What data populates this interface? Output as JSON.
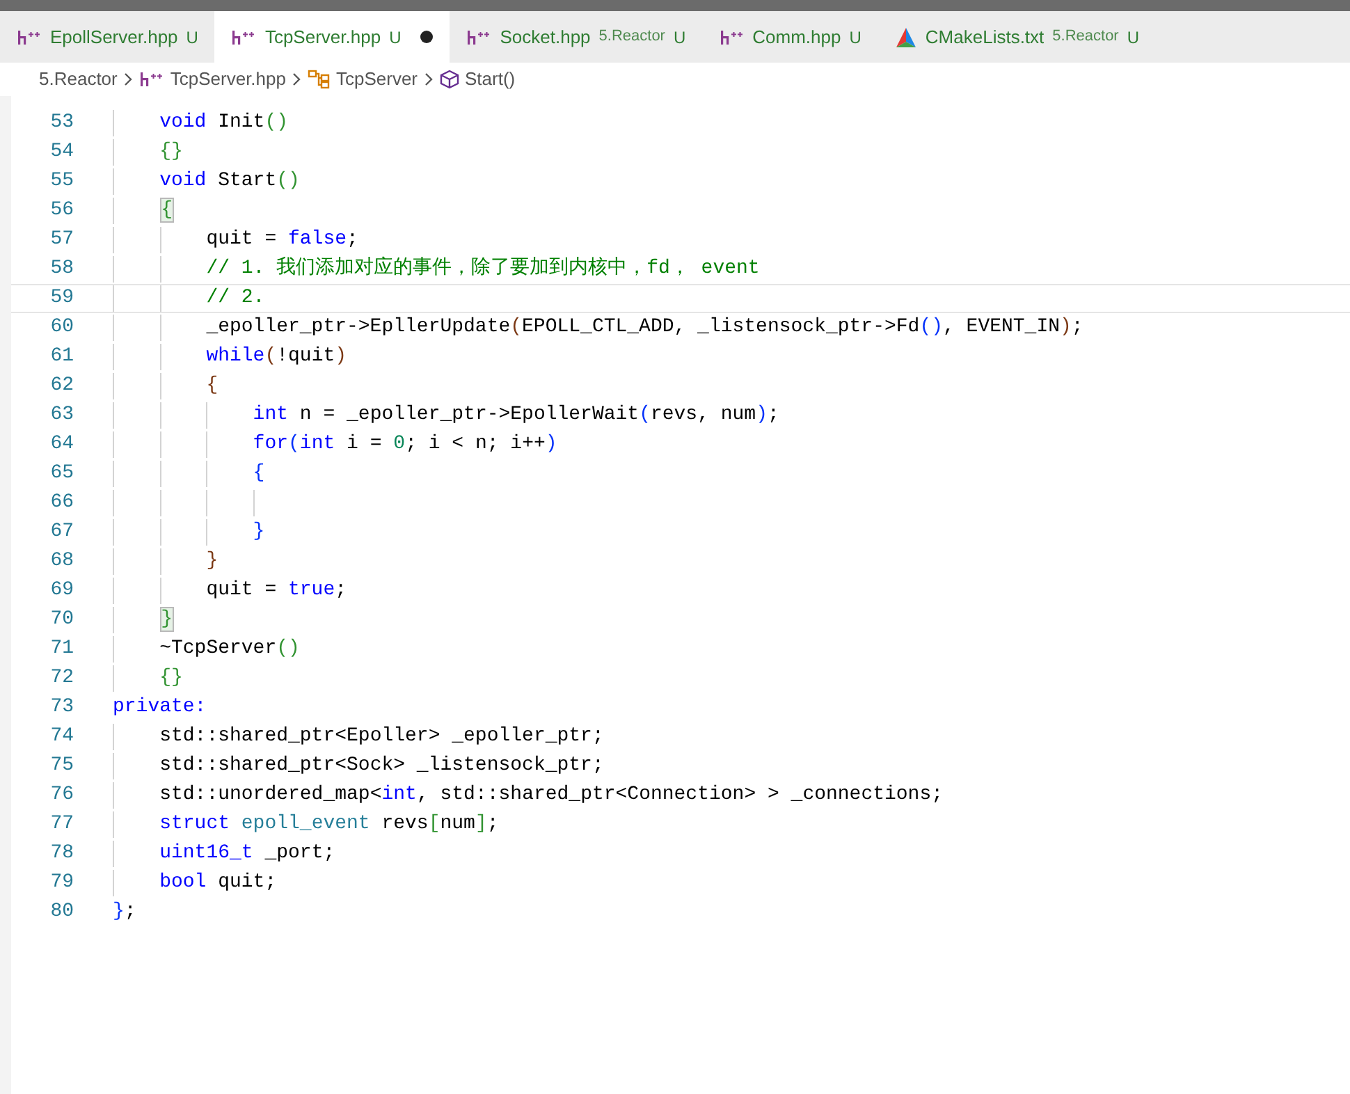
{
  "tabs": [
    {
      "kind": "header",
      "label": "EpollServer.hpp",
      "status": "U",
      "modified": false,
      "selected": false
    },
    {
      "kind": "header",
      "label": "TcpServer.hpp",
      "status": "U",
      "modified": true,
      "selected": true
    },
    {
      "kind": "header",
      "label": "Socket.hpp",
      "detail": "5.Reactor",
      "status": "U",
      "modified": false,
      "selected": false
    },
    {
      "kind": "header",
      "label": "Comm.hpp",
      "status": "U",
      "modified": false,
      "selected": false
    },
    {
      "kind": "cmake",
      "label": "CMakeLists.txt",
      "detail": "5.Reactor",
      "status": "U",
      "modified": false,
      "selected": false
    }
  ],
  "breadcrumb": [
    {
      "kind": "folder",
      "label": "5.Reactor"
    },
    {
      "kind": "header",
      "label": "TcpServer.hpp"
    },
    {
      "kind": "class",
      "label": "TcpServer"
    },
    {
      "kind": "method",
      "label": "Start()"
    }
  ],
  "editor": {
    "lines": [
      {
        "children": [
          {
            "number": "53",
            "current": false,
            "tokens": [
              {
                "kind": "kw",
                "text": "void"
              },
              {
                "kind": "plain",
                "text": " Init"
              },
              {
                "kind": "b1",
                "text": "()"
              }
            ]
          },
          {
            "number": "54",
            "current": false,
            "tokens": [
              {
                "kind": "b1",
                "text": "{}"
              }
            ]
          },
          {
            "number": "55",
            "current": false,
            "tokens": [
              {
                "kind": "kw",
                "text": "void"
              },
              {
                "kind": "plain",
                "text": " Start"
              },
              {
                "kind": "b1",
                "text": "()"
              }
            ]
          },
          {
            "number": "56",
            "current": false,
            "tokens": [
              {
                "kind": "b1",
                "text": "{",
                "matched": true
              }
            ],
            "children": [
              {
                "number": "57",
                "current": false,
                "tokens": [
                  {
                    "kind": "plain",
                    "text": "quit = "
                  },
                  {
                    "kind": "kw",
                    "text": "false"
                  },
                  {
                    "kind": "plain",
                    "text": ";"
                  }
                ]
              },
              {
                "number": "58",
                "current": false,
                "tokens": [
                  {
                    "kind": "comment",
                    "text": "// 1. 我们添加对应的事件，除了要加到内核中，fd， event"
                  }
                ]
              },
              {
                "number": "59",
                "current": true,
                "tokens": [
                  {
                    "kind": "comment",
                    "text": "// 2."
                  }
                ]
              },
              {
                "number": "60",
                "current": false,
                "tokens": [
                  {
                    "kind": "plain",
                    "text": "_epoller_ptr->EpllerUpdate"
                  },
                  {
                    "kind": "b2",
                    "text": "("
                  },
                  {
                    "kind": "plain",
                    "text": "EPOLL_CTL_ADD, _listensock_ptr->Fd"
                  },
                  {
                    "kind": "b3",
                    "text": "()"
                  },
                  {
                    "kind": "plain",
                    "text": ", EVENT_IN"
                  },
                  {
                    "kind": "b2",
                    "text": ")"
                  },
                  {
                    "kind": "plain",
                    "text": ";"
                  }
                ]
              },
              {
                "number": "61",
                "current": false,
                "tokens": [
                  {
                    "kind": "kw",
                    "text": "while"
                  },
                  {
                    "kind": "b2",
                    "text": "("
                  },
                  {
                    "kind": "plain",
                    "text": "!quit"
                  },
                  {
                    "kind": "b2",
                    "text": ")"
                  }
                ]
              },
              {
                "number": "62",
                "current": false,
                "tokens": [
                  {
                    "kind": "b2",
                    "text": "{"
                  }
                ],
                "children": [
                  {
                    "number": "63",
                    "current": false,
                    "tokens": [
                      {
                        "kind": "kw",
                        "text": "int"
                      },
                      {
                        "kind": "plain",
                        "text": " n = _epoller_ptr->EpollerWait"
                      },
                      {
                        "kind": "b3",
                        "text": "("
                      },
                      {
                        "kind": "plain",
                        "text": "revs, num"
                      },
                      {
                        "kind": "b3",
                        "text": ")"
                      },
                      {
                        "kind": "plain",
                        "text": ";"
                      }
                    ]
                  },
                  {
                    "number": "64",
                    "current": false,
                    "tokens": [
                      {
                        "kind": "kw",
                        "text": "for"
                      },
                      {
                        "kind": "b3",
                        "text": "("
                      },
                      {
                        "kind": "kw",
                        "text": "int"
                      },
                      {
                        "kind": "plain",
                        "text": " i = "
                      },
                      {
                        "kind": "num",
                        "text": "0"
                      },
                      {
                        "kind": "plain",
                        "text": "; i < n; i++"
                      },
                      {
                        "kind": "b3",
                        "text": ")"
                      }
                    ]
                  },
                  {
                    "number": "65",
                    "current": false,
                    "tokens": [
                      {
                        "kind": "b3",
                        "text": "{"
                      }
                    ],
                    "children": [
                      {
                        "number": "66",
                        "current": false
                      }
                    ]
                  },
                  {
                    "number": "67",
                    "current": false,
                    "tokens": [
                      {
                        "kind": "b3",
                        "text": "}"
                      }
                    ]
                  }
                ]
              },
              {
                "number": "68",
                "current": false,
                "tokens": [
                  {
                    "kind": "b2",
                    "text": "}"
                  }
                ]
              },
              {
                "number": "69",
                "current": false,
                "tokens": [
                  {
                    "kind": "plain",
                    "text": "quit = "
                  },
                  {
                    "kind": "kw",
                    "text": "true"
                  },
                  {
                    "kind": "plain",
                    "text": ";"
                  }
                ]
              }
            ]
          },
          {
            "number": "70",
            "current": false,
            "tokens": [
              {
                "kind": "b1",
                "text": "}",
                "matched": true
              }
            ]
          },
          {
            "number": "71",
            "current": false,
            "tokens": [
              {
                "kind": "plain",
                "text": "~TcpServer"
              },
              {
                "kind": "b1",
                "text": "()"
              }
            ]
          },
          {
            "number": "72",
            "current": false,
            "tokens": [
              {
                "kind": "b1",
                "text": "{}"
              }
            ]
          }
        ]
      },
      {
        "number": "73",
        "current": false,
        "tokens": [
          {
            "kind": "kw",
            "text": "private:"
          }
        ],
        "children": [
          {
            "number": "74",
            "current": false,
            "tokens": [
              {
                "kind": "plain",
                "text": "std::shared_ptr<Epoller> _epoller_ptr;"
              }
            ]
          },
          {
            "number": "75",
            "current": false,
            "tokens": [
              {
                "kind": "plain",
                "text": "std::shared_ptr<Sock> _listensock_ptr;"
              }
            ]
          },
          {
            "number": "76",
            "current": false,
            "tokens": [
              {
                "kind": "plain",
                "text": "std::unordered_map<"
              },
              {
                "kind": "kw",
                "text": "int"
              },
              {
                "kind": "plain",
                "text": ", std::shared_ptr<Connection> > _connections;"
              }
            ]
          },
          {
            "number": "77",
            "current": false,
            "tokens": [
              {
                "kind": "kw",
                "text": "struct "
              },
              {
                "kind": "type",
                "text": "epoll_event"
              },
              {
                "kind": "plain",
                "text": " revs"
              },
              {
                "kind": "b1",
                "text": "["
              },
              {
                "kind": "plain",
                "text": "num"
              },
              {
                "kind": "b1",
                "text": "]"
              },
              {
                "kind": "plain",
                "text": ";"
              }
            ]
          },
          {
            "number": "78",
            "current": false,
            "tokens": [
              {
                "kind": "kw",
                "text": "uint16_t"
              },
              {
                "kind": "plain",
                "text": " _port;"
              }
            ]
          },
          {
            "number": "79",
            "current": false,
            "tokens": [
              {
                "kind": "kw",
                "text": "bool"
              },
              {
                "kind": "plain",
                "text": " quit;"
              }
            ]
          }
        ]
      },
      {
        "number": "80",
        "current": false,
        "tokens": [
          {
            "kind": "b3",
            "text": "}"
          },
          {
            "kind": "plain",
            "text": ";"
          }
        ]
      }
    ]
  }
}
